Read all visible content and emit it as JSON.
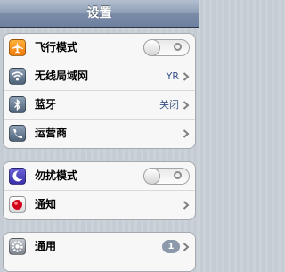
{
  "header": {
    "title": "设置"
  },
  "group1": [
    {
      "label": "飞行模式",
      "icon": "airplane-icon",
      "toggle": "off"
    },
    {
      "label": "无线局域网",
      "icon": "wifi-icon",
      "value": "YR"
    },
    {
      "label": "蓝牙",
      "icon": "bluetooth-icon",
      "value": "关闭"
    },
    {
      "label": "运营商",
      "icon": "carrier-icon"
    }
  ],
  "group2": [
    {
      "label": "勿扰模式",
      "icon": "moon-icon",
      "toggle": "off"
    },
    {
      "label": "通知",
      "icon": "notification-icon"
    }
  ],
  "group3": [
    {
      "label": "通用",
      "icon": "gear-icon",
      "badge": "1"
    }
  ],
  "colors": {
    "nav_bar": "#6d80a0",
    "value_text": "#385487",
    "badge": "#8c99ab",
    "airplane_icon": "#f07b0a",
    "moon_icon": "#3a2fa8"
  }
}
